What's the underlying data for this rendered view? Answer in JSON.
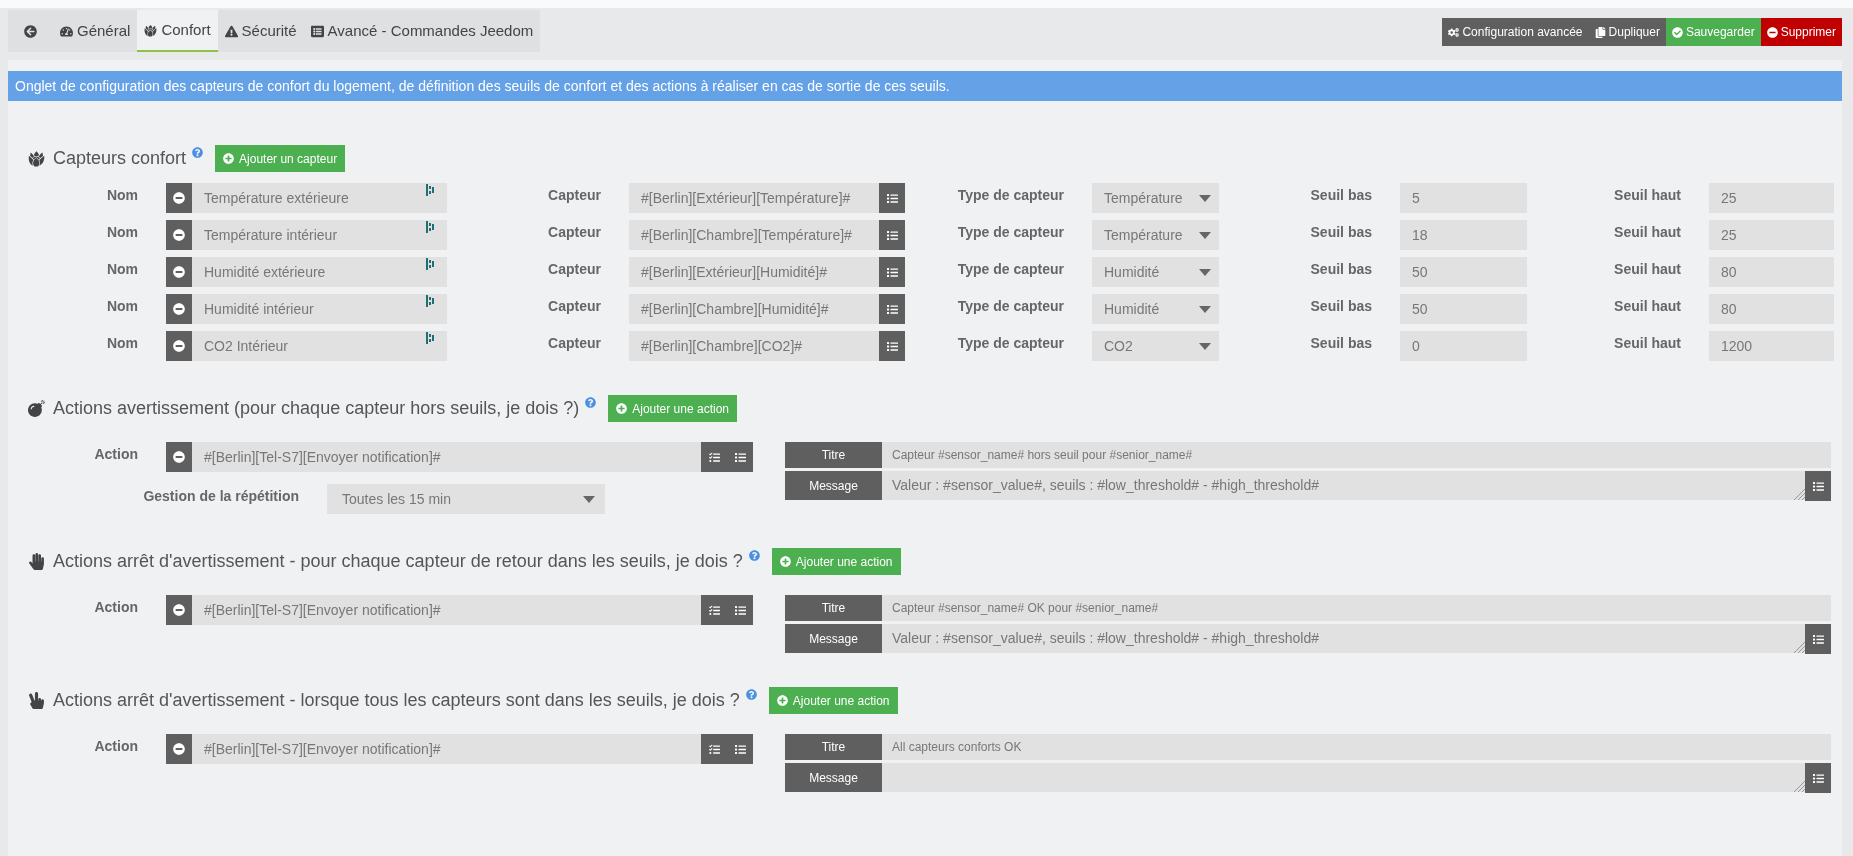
{
  "tabs": [
    {
      "label": "Général",
      "selected": false
    },
    {
      "label": "Confort",
      "selected": true
    },
    {
      "label": "Sécurité",
      "selected": false
    },
    {
      "label": "Avancé - Commandes Jeedom",
      "selected": false
    }
  ],
  "toolbar_buttons": [
    {
      "label": "Configuration avancée",
      "kind": "neutral"
    },
    {
      "label": "Dupliquer",
      "kind": "neutral"
    },
    {
      "label": "Sauvegarder",
      "kind": "success"
    },
    {
      "label": "Supprimer",
      "kind": "danger"
    }
  ],
  "info_banner": "Onglet de configuration des capteurs de confort du logement, de définition des seuils de confort et des actions à réaliser en cas de sortie de ces seuils.",
  "sensors_section": {
    "title": "Capteurs confort",
    "add_button": "Ajouter un capteur",
    "sensors": [
      {
        "name_label": "Nom",
        "name": "Température extérieure",
        "sensor_label": "Capteur",
        "sensor": "#[Berlin][Extérieur][Température]#",
        "type_label": "Type de capteur",
        "type": "Température",
        "low_label": "Seuil bas",
        "low": "5",
        "high_label": "Seuil haut",
        "high": "25"
      },
      {
        "name_label": "Nom",
        "name": "Température intérieur",
        "sensor_label": "Capteur",
        "sensor": "#[Berlin][Chambre][Température]#",
        "type_label": "Type de capteur",
        "type": "Température",
        "low_label": "Seuil bas",
        "low": "18",
        "high_label": "Seuil haut",
        "high": "25"
      },
      {
        "name_label": "Nom",
        "name": "Humidité extérieure",
        "sensor_label": "Capteur",
        "sensor": "#[Berlin][Extérieur][Humidité]#",
        "type_label": "Type de capteur",
        "type": "Humidité",
        "low_label": "Seuil bas",
        "low": "50",
        "high_label": "Seuil haut",
        "high": "80"
      },
      {
        "name_label": "Nom",
        "name": "Humidité intérieur",
        "sensor_label": "Capteur",
        "sensor": "#[Berlin][Chambre][Humidité]#",
        "type_label": "Type de capteur",
        "type": "Humidité",
        "low_label": "Seuil bas",
        "low": "50",
        "high_label": "Seuil haut",
        "high": "80"
      },
      {
        "name_label": "Nom",
        "name": "CO2 Intérieur",
        "sensor_label": "Capteur",
        "sensor": "#[Berlin][Chambre][CO2]#",
        "type_label": "Type de capteur",
        "type": "CO2",
        "low_label": "Seuil bas",
        "low": "0",
        "high_label": "Seuil haut",
        "high": "1200"
      }
    ]
  },
  "action_sections": [
    {
      "title": "Actions avertissement (pour chaque capteur hors seuils, je dois ?)",
      "add_button": "Ajouter une action",
      "actions": [
        {
          "action_label": "Action",
          "command": "#[Berlin][Tel-S7][Envoyer notification]#",
          "title_label": "Titre",
          "title": "Capteur #sensor_name# hors seuil pour #senior_name#",
          "message_label": "Message",
          "message": "Valeur : #sensor_value#, seuils : #low_threshold# - #high_threshold#"
        }
      ],
      "repetition": {
        "label": "Gestion de la répétition",
        "value": "Toutes les 15 min"
      }
    },
    {
      "title": "Actions arrêt d'avertissement - pour chaque capteur de retour dans les seuils, je dois ?",
      "add_button": "Ajouter une action",
      "actions": [
        {
          "action_label": "Action",
          "command": "#[Berlin][Tel-S7][Envoyer notification]#",
          "title_label": "Titre",
          "title": "Capteur #sensor_name# OK pour #senior_name#",
          "message_label": "Message",
          "message": "Valeur : #sensor_value#, seuils : #low_threshold# - #high_threshold#"
        }
      ]
    },
    {
      "title": "Actions arrêt d'avertissement - lorsque tous les capteurs sont dans les seuils, je dois ?",
      "add_button": "Ajouter une action",
      "actions": [
        {
          "action_label": "Action",
          "command": "#[Berlin][Tel-S7][Envoyer notification]#",
          "title_label": "Titre",
          "title": "All capteurs conforts OK",
          "message_label": "Message"
        }
      ]
    }
  ]
}
